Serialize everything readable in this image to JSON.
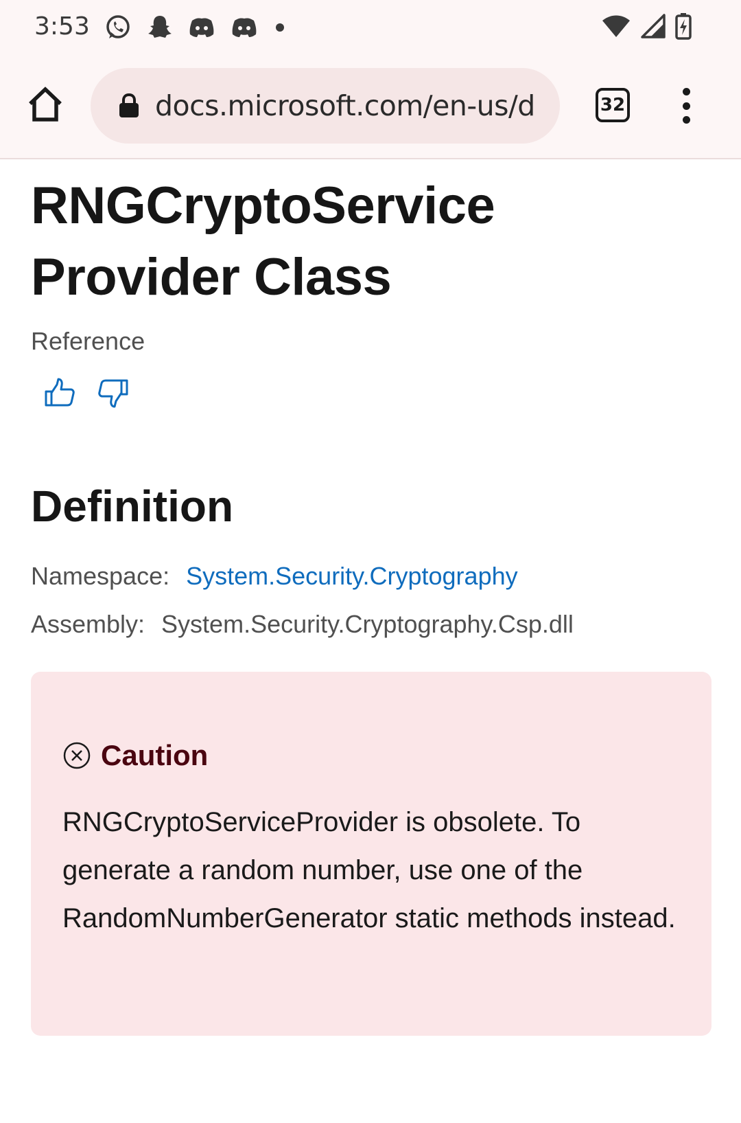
{
  "status_bar": {
    "time": "3:53",
    "left_icons": [
      "whatsapp-icon",
      "snapchat-icon",
      "discord-icon",
      "discord-icon",
      "notification-dot-icon"
    ],
    "right_icons": [
      "wifi-icon",
      "cell-signal-icon",
      "battery-charging-icon"
    ]
  },
  "browser": {
    "url": "docs.microsoft.com/en-us/d",
    "tab_count": "32",
    "colors": {
      "toolbar_bg": "#fdf6f6",
      "url_bar_bg": "#f5e6e6"
    }
  },
  "page": {
    "title": "RNGCryptoServiceProvider Class",
    "title_line1": "RNGCryptoService",
    "title_line2": "Provider Class",
    "subtitle": "Reference",
    "section_heading": "Definition",
    "namespace_label": "Namespace:",
    "namespace_value": "System.Security.Cryptography",
    "assembly_label": "Assembly:",
    "assembly_value": "System.Security.Cryptography.Csp.dll",
    "caution": {
      "title": "Caution",
      "text": "RNGCryptoServiceProvider is obsolete. To generate a random number, use one of the RandomNumberGenerator static methods instead."
    },
    "colors": {
      "link": "#0f6cbd",
      "caution_bg": "#fbe6e8",
      "caution_title": "#4a0510"
    }
  }
}
